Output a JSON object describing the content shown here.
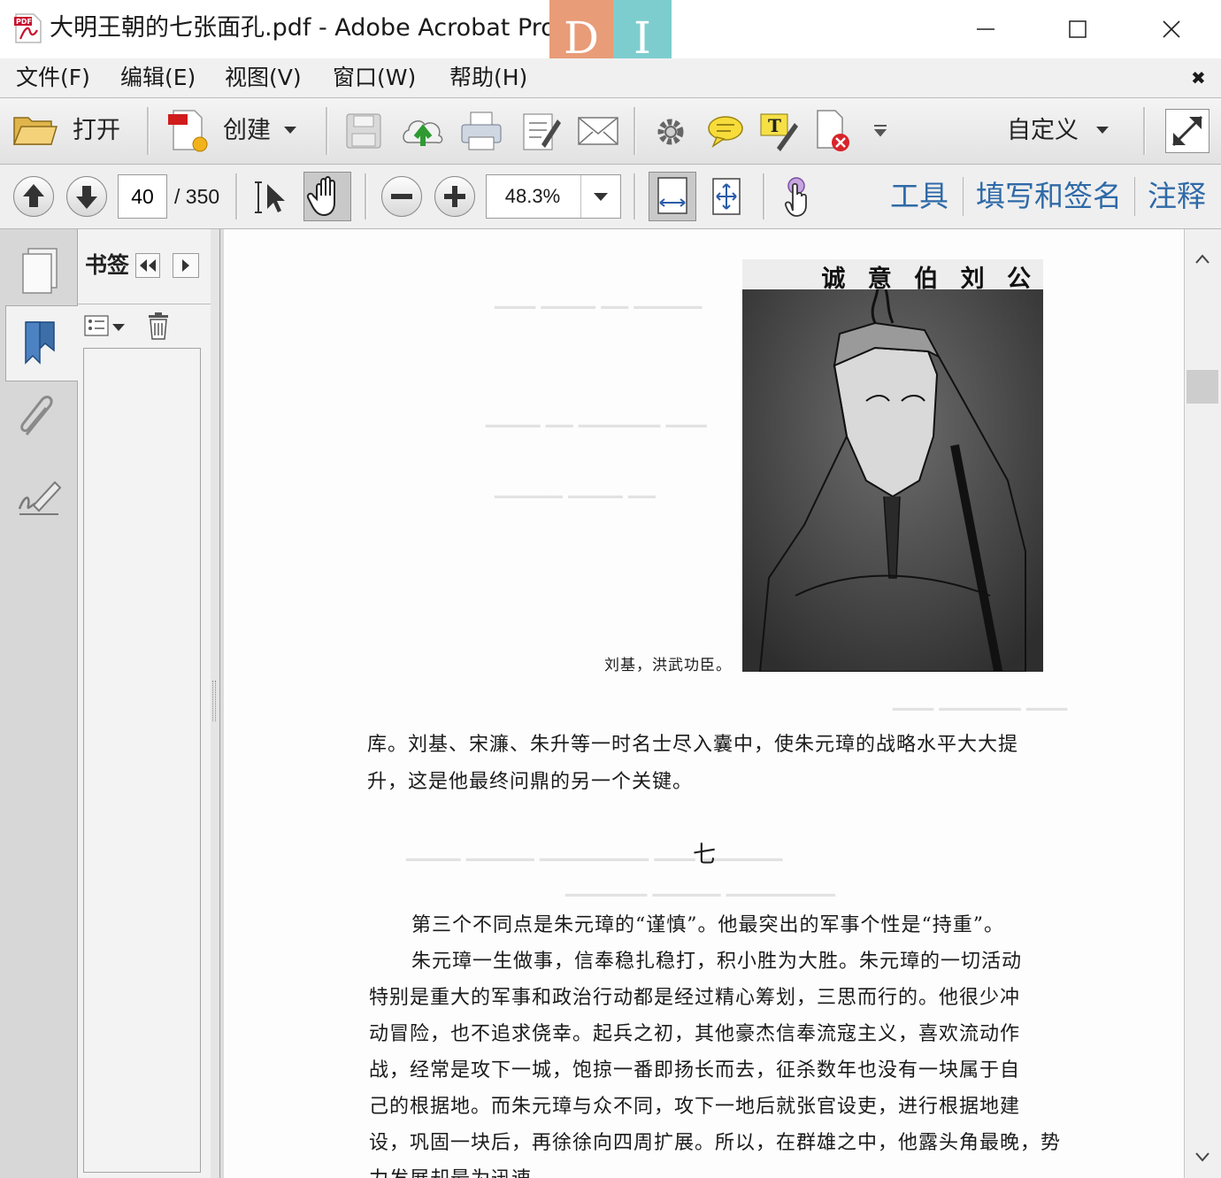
{
  "window": {
    "title": "大明王朝的七张面孔.pdf - Adobe Acrobat Pro",
    "badges": [
      "D",
      "I"
    ]
  },
  "menu": [
    "文件(F)",
    "编辑(E)",
    "视图(V)",
    "窗口(W)",
    "帮助(H)"
  ],
  "menu_close": "✖",
  "toolbar": {
    "open_label": "打开",
    "create_label": "创建",
    "customize_label": "自定义"
  },
  "nav": {
    "page_number": "40",
    "page_total": "/ 350",
    "zoom": "48.3%"
  },
  "right_panel_links": [
    "工具",
    "填写和签名",
    "注释"
  ],
  "bookmarks": {
    "title": "书签"
  },
  "document": {
    "portrait_header": "诚 意 伯 刘 公",
    "portrait_caption": "刘基，洪武功臣。",
    "paragraph_1": [
      "库。刘基、宋濂、朱升等一时名士尽入囊中，使朱元璋的战略水平大大提",
      "升，这是他最终问鼎的另一个关键。"
    ],
    "section_heading": "七",
    "paragraph_2": [
      "第三个不同点是朱元璋的“谨慎”。他最突出的军事个性是“持重”。",
      "朱元璋一生做事，信奉稳扎稳打，积小胜为大胜。朱元璋的一切活动",
      "特别是重大的军事和政治行动都是经过精心筹划，三思而行的。他很少冲",
      "动冒险，也不追求侥幸。起兵之初，其他豪杰信奉流寇主义，喜欢流动作",
      "战，经常是攻下一城，饱掠一番即扬长而去，征杀数年也没有一块属于自",
      "己的根据地。而朱元璋与众不同，攻下一地后就张官设吏，进行根据地建",
      "设，巩固一块后，再徐徐向四周扩展。所以，在群雄之中，他露头角最晚，势",
      "力发展却最为迅速"
    ]
  }
}
